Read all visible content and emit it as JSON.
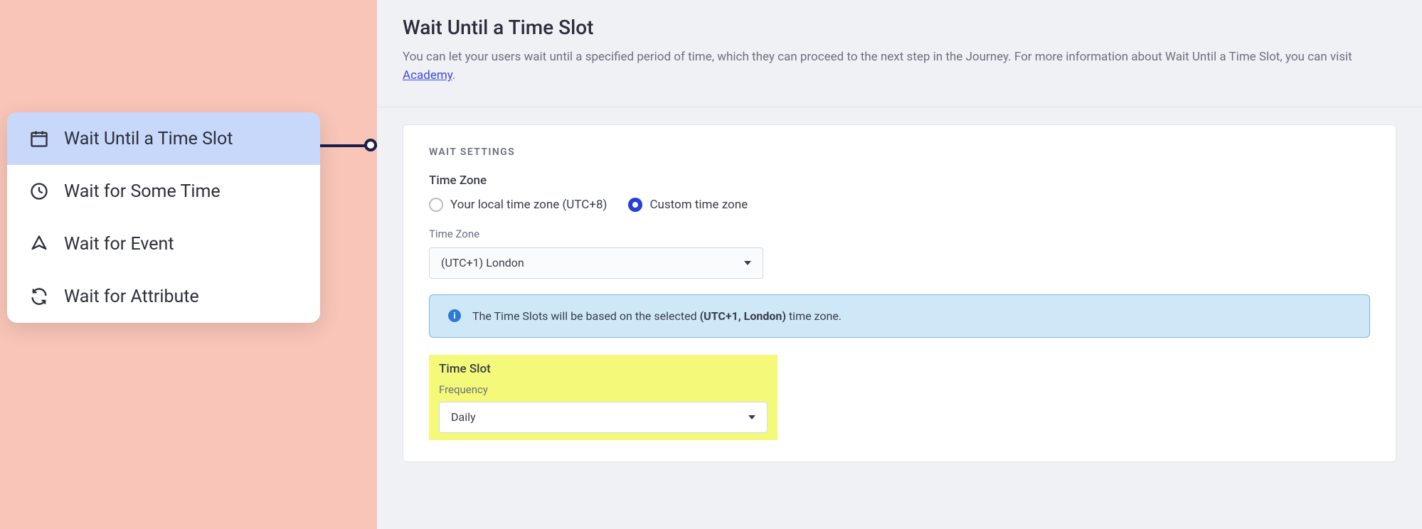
{
  "menu": {
    "items": [
      {
        "label": "Wait Until a Time Slot",
        "icon": "calendar-icon"
      },
      {
        "label": "Wait for Some Time",
        "icon": "clock-icon"
      },
      {
        "label": "Wait for Event",
        "icon": "pointer-icon"
      },
      {
        "label": "Wait for Attribute",
        "icon": "refresh-icon"
      }
    ]
  },
  "header": {
    "title": "Wait Until a Time Slot",
    "desc_prefix": "You can let your users wait until a specified period of time, which they can proceed to the next step in the Journey. For more information about Wait Until a Time Slot, you can visit ",
    "desc_link": "Academy",
    "desc_suffix": "."
  },
  "settings": {
    "section_label": "WAIT SETTINGS",
    "timezone_label": "Time Zone",
    "radio_local": "Your local time zone (UTC+8)",
    "radio_custom": "Custom time zone",
    "timezone_sub": "Time Zone",
    "timezone_value": "(UTC+1) London",
    "info_prefix": "The Time Slots will be based on the selected ",
    "info_bold": "(UTC+1, London)",
    "info_suffix": " time zone.",
    "timeslot_label": "Time Slot",
    "frequency_label": "Frequency",
    "frequency_value": "Daily"
  }
}
